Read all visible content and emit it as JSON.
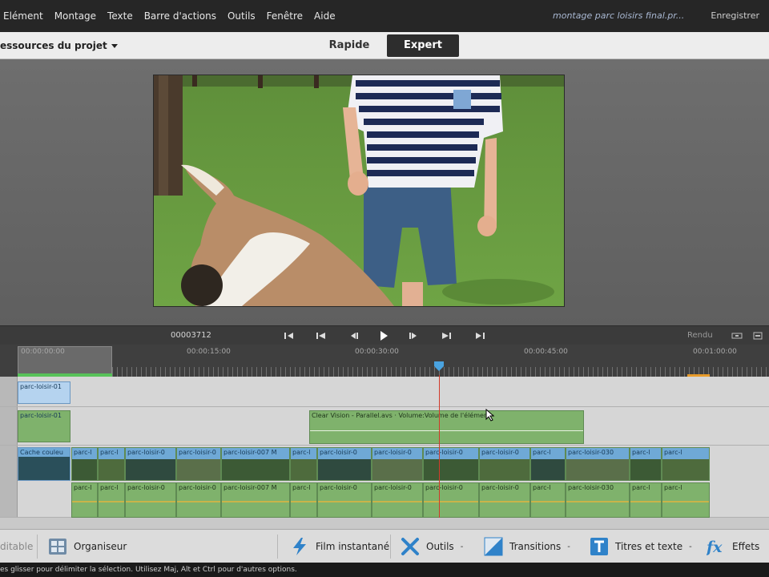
{
  "menu": {
    "items": [
      "Elément",
      "Montage",
      "Texte",
      "Barre d'actions",
      "Outils",
      "Fenêtre",
      "Aide"
    ],
    "document_title": "montage parc loisirs final.pr...",
    "save_label": "Enregistrer"
  },
  "modebar": {
    "assets_label": "essources du projet",
    "tab_quick": "Rapide",
    "tab_expert": "Expert",
    "active_tab": "Expert"
  },
  "transport": {
    "timecode": "00003712",
    "render_label": "Rendu"
  },
  "ruler": {
    "labels": [
      "00:00:00:00",
      "00:00:15:00",
      "00:00:30:00",
      "00:00:45:00",
      "00:01:00:00"
    ]
  },
  "tracks": {
    "video2_clip": "parc-loisir-01",
    "audio2_clip": "parc-loisir-01",
    "effect_clip_label": "Clear Vision - Parallel.avs · Volume:Volume de l'élément ·",
    "color_matte_label": "Cache couleu",
    "video_clips": [
      "parc-l",
      "parc-l",
      "parc-loisir-0",
      "parc-loisir-0",
      "parc-loisir-007 M",
      "parc-l",
      "parc-loisir-0",
      "parc-loisir-0",
      "parc-loisir-0",
      "parc-loisir-0",
      "parc-l",
      "parc-loisir-030",
      "parc-l",
      "parc-l"
    ],
    "audio_clips": [
      "parc-l",
      "parc-l",
      "parc-loisir-0",
      "parc-loisir-0",
      "parc-loisir-007 M",
      "parc-l",
      "parc-loisir-0",
      "parc-loisir-0",
      "parc-loisir-0",
      "parc-loisir-0",
      "parc-l",
      "parc-loisir-030",
      "parc-l",
      "parc-l"
    ]
  },
  "toolbar": {
    "left_partial": "ditable",
    "organizer": "Organiseur",
    "instant_movie": "Film instantané",
    "tools": "Outils",
    "transitions": "Transitions",
    "titles": "Titres et texte",
    "effects": "Effets",
    "dropdown_marker": "-"
  },
  "status": {
    "text": "es glisser pour délimiter la sélection. Utilisez Maj, Alt et Ctrl pour d'autres options."
  },
  "colors": {
    "accent_playhead": "#d23a2a",
    "playhead_marker": "#4aa3e0",
    "clip_blue": "#6fa9d6",
    "clip_green": "#8fc07c"
  }
}
